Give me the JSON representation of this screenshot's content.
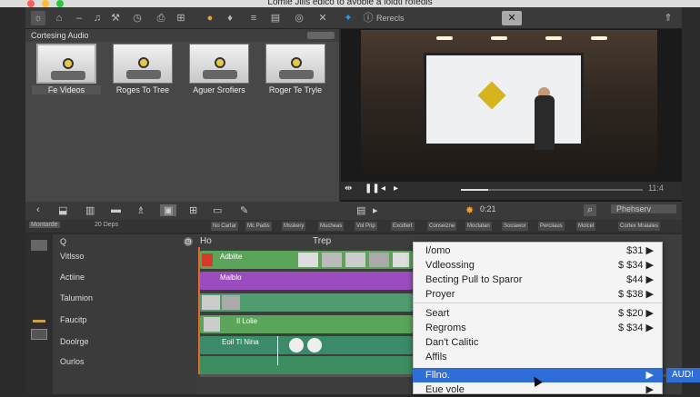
{
  "window": {
    "title": "Lomie Jiils edico to avoble a loidti rofedis"
  },
  "toolbar": {
    "icons": [
      "gear-icon",
      "home-icon",
      "minus-icon",
      "music-icon",
      "wand-icon",
      "clock-icon",
      "export-icon",
      "grid-icon",
      "color-icon",
      "drop-icon",
      "bars-icon",
      "target-icon",
      "close-icon",
      "twitter-icon",
      "info-icon"
    ],
    "refresh_label": "Rerecls"
  },
  "library": {
    "header": "Cortesing Audio",
    "clips": [
      {
        "label": "Fe Videos"
      },
      {
        "label": "Roges To Tree"
      },
      {
        "label": "Aguer Srofiers"
      },
      {
        "label": "Roger Te Tryle"
      }
    ]
  },
  "viewer": {
    "time_current": "0:21",
    "timecode": "11:4"
  },
  "timeline_toolbar": {
    "counter": "0:21",
    "share_label": "Phehserv"
  },
  "clip_bar": {
    "left_label": "Montarde",
    "duration": "20 Deps",
    "buttons": [
      "No Cartar",
      "Mc Padis",
      "Msskery",
      "Mucheas",
      "Vol Prip",
      "Excittert",
      "Conseizne",
      "Moctatan",
      "Sociawor",
      "Perciiaus",
      "Molcel",
      "Cortex Mraiales"
    ]
  },
  "tracks": {
    "search_glyph": "Q",
    "ruler": [
      "Ho",
      "Trep"
    ],
    "names": [
      "Vitlsso",
      "Actiine",
      "Talumion",
      "Faucitp",
      "Doolrge",
      "Ourlos"
    ]
  },
  "clips": [
    {
      "label": "Adblite",
      "color": "#5aa55a"
    },
    {
      "label": "Malblo",
      "color": "#9b4dbf"
    },
    {
      "label": "",
      "color": "#4f9d6e"
    },
    {
      "label": "Il Lolie",
      "color": "#5aa55a"
    },
    {
      "label": "Eoil Tl Nina",
      "color": "#3b8a6a"
    }
  ],
  "context_menu": {
    "items": [
      {
        "label": "I/omo",
        "price": "$31 ▶"
      },
      {
        "label": "Vdleossing",
        "price": "$ $34 ▶"
      },
      {
        "label": "Becting Pull to Sparor",
        "price": "$44 ▶"
      },
      {
        "label": "Proyer",
        "price": "$ $38 ▶"
      },
      {
        "label": "Seart",
        "price": "$ $20 ▶"
      },
      {
        "label": "Regroms",
        "price": "$ $34 ▶"
      },
      {
        "label": "Dan't Calitic",
        "price": ""
      },
      {
        "label": "Affils",
        "price": ""
      },
      {
        "label": "Fllno.",
        "price": "▶"
      },
      {
        "label": "Eue vole",
        "price": "▶"
      }
    ],
    "selected_index": 8,
    "submenu_label": "AUDI"
  },
  "colors": {
    "accent": "#2e6ed6",
    "purple_clip": "#9b4dbf",
    "green_clip": "#5aa55a"
  }
}
